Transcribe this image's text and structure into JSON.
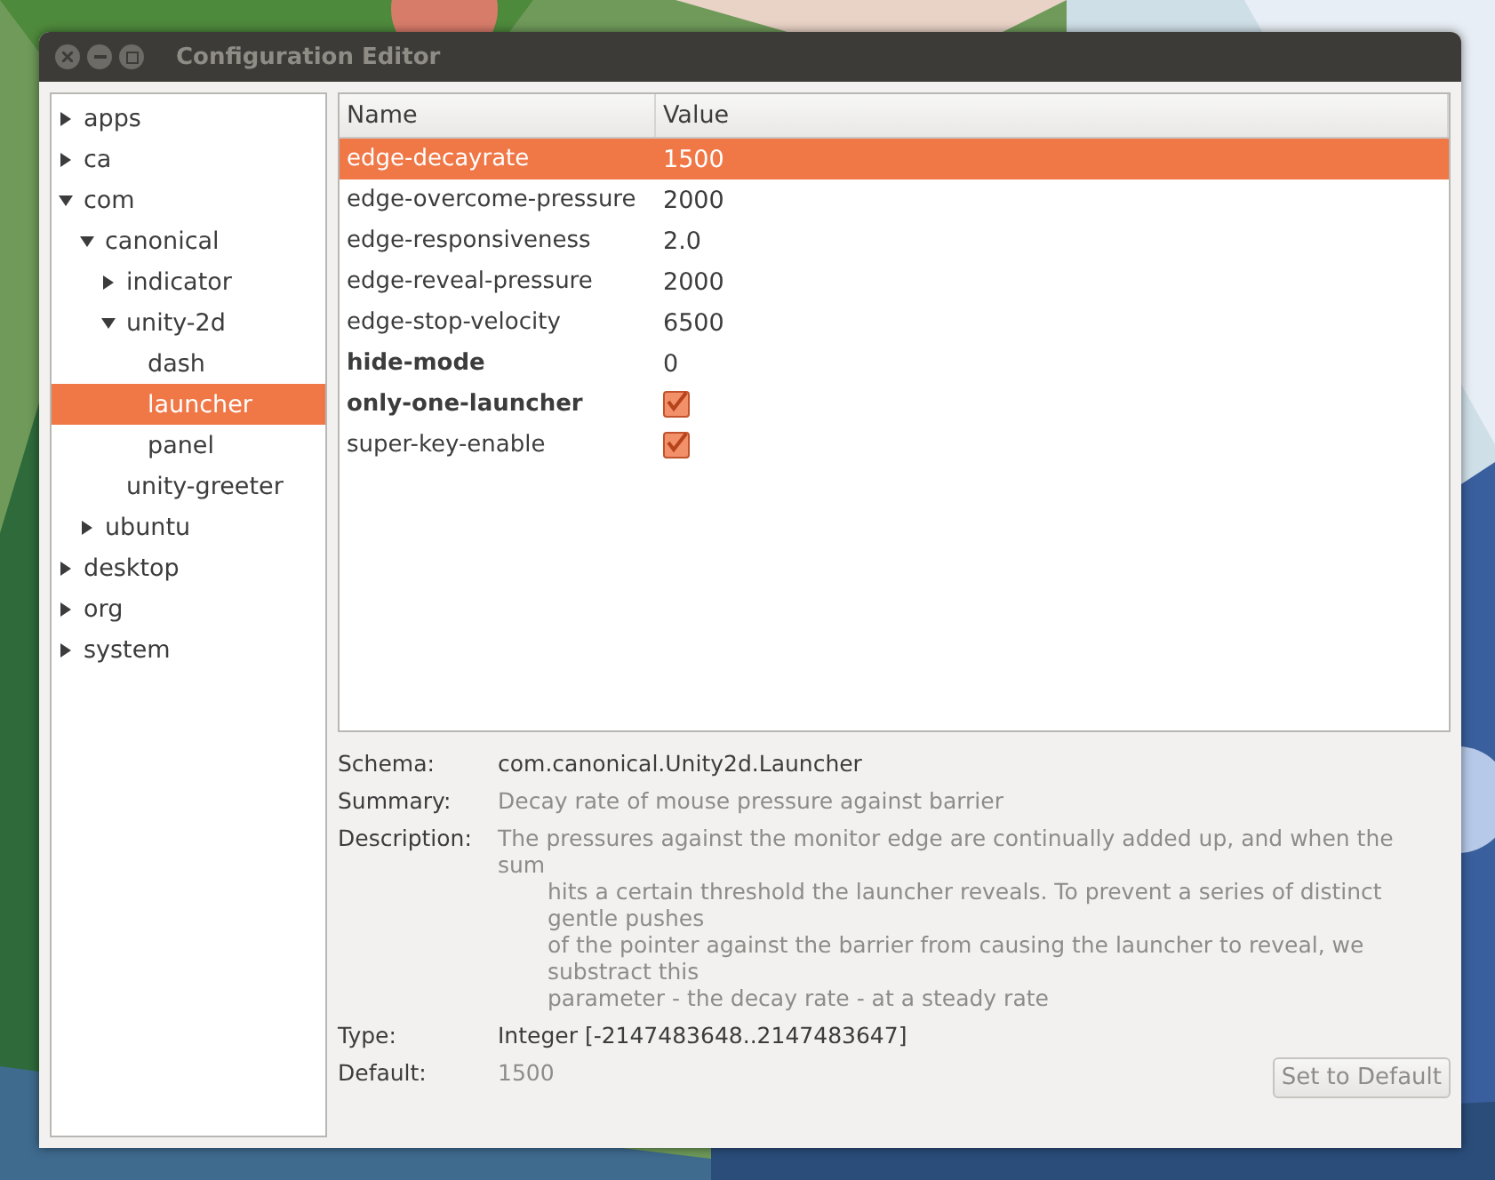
{
  "window": {
    "title": "Configuration Editor"
  },
  "tree": [
    {
      "label": "apps",
      "expanded": false,
      "selected": false
    },
    {
      "label": "ca",
      "expanded": false,
      "selected": false
    },
    {
      "label": "com",
      "expanded": true,
      "selected": false,
      "children": [
        {
          "label": "canonical",
          "expanded": true,
          "selected": false,
          "children": [
            {
              "label": "indicator",
              "expanded": false,
              "selected": false
            },
            {
              "label": "unity-2d",
              "expanded": true,
              "selected": false,
              "children": [
                {
                  "label": "dash",
                  "selected": false
                },
                {
                  "label": "launcher",
                  "selected": true
                },
                {
                  "label": "panel",
                  "selected": false
                }
              ]
            },
            {
              "label": "unity-greeter",
              "selected": false
            }
          ]
        },
        {
          "label": "ubuntu",
          "expanded": false,
          "selected": false
        }
      ]
    },
    {
      "label": "desktop",
      "expanded": false,
      "selected": false
    },
    {
      "label": "org",
      "expanded": false,
      "selected": false
    },
    {
      "label": "system",
      "expanded": false,
      "selected": false
    }
  ],
  "table": {
    "columns": [
      "Name",
      "Value"
    ],
    "rows": [
      {
        "name": "edge-decayrate",
        "kind": "text",
        "value": "1500",
        "modified": false,
        "selected": true
      },
      {
        "name": "edge-overcome-pressure",
        "kind": "text",
        "value": "2000",
        "modified": false,
        "selected": false
      },
      {
        "name": "edge-responsiveness",
        "kind": "text",
        "value": "2.0",
        "modified": false,
        "selected": false
      },
      {
        "name": "edge-reveal-pressure",
        "kind": "text",
        "value": "2000",
        "modified": false,
        "selected": false
      },
      {
        "name": "edge-stop-velocity",
        "kind": "text",
        "value": "6500",
        "modified": false,
        "selected": false
      },
      {
        "name": "hide-mode",
        "kind": "text",
        "value": "0",
        "modified": true,
        "selected": false
      },
      {
        "name": "only-one-launcher",
        "kind": "checkbox",
        "checked": true,
        "modified": true,
        "selected": false
      },
      {
        "name": "super-key-enable",
        "kind": "checkbox",
        "checked": true,
        "modified": false,
        "selected": false
      }
    ]
  },
  "details": [
    {
      "label": "Schema:",
      "kind": "plain",
      "value": "com.canonical.Unity2d.Launcher"
    },
    {
      "label": "Summary:",
      "kind": "dim",
      "value": "Decay rate of mouse pressure against barrier"
    },
    {
      "label": "Description:",
      "kind": "lines",
      "lines": [
        "The pressures against the monitor edge are continually added up, and when the sum",
        "hits a certain threshold the launcher reveals. To prevent a series of distinct gentle pushes",
        "of the pointer against the barrier from causing the launcher to reveal, we substract this",
        "parameter - the decay rate - at a steady rate"
      ]
    },
    {
      "label": "Type:",
      "kind": "plain",
      "value": "Integer [-2147483648..2147483647]"
    },
    {
      "label": "Default:",
      "kind": "dim",
      "value": "1500"
    }
  ],
  "reset_button": {
    "label": "Set to Default",
    "disabled": true
  }
}
